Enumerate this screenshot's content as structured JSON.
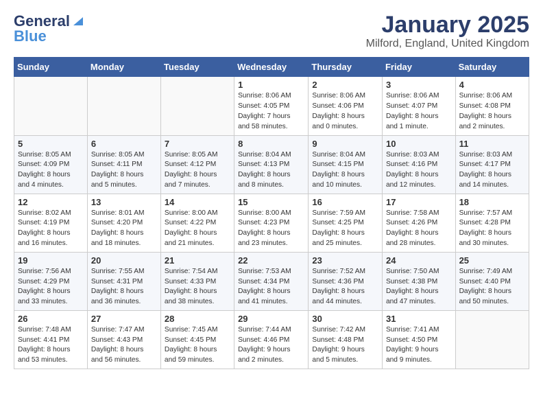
{
  "header": {
    "logo_general": "General",
    "logo_blue": "Blue",
    "title": "January 2025",
    "subtitle": "Milford, England, United Kingdom"
  },
  "days_of_week": [
    "Sunday",
    "Monday",
    "Tuesday",
    "Wednesday",
    "Thursday",
    "Friday",
    "Saturday"
  ],
  "weeks": [
    [
      {
        "day": "",
        "info": ""
      },
      {
        "day": "",
        "info": ""
      },
      {
        "day": "",
        "info": ""
      },
      {
        "day": "1",
        "info": "Sunrise: 8:06 AM\nSunset: 4:05 PM\nDaylight: 7 hours\nand 58 minutes."
      },
      {
        "day": "2",
        "info": "Sunrise: 8:06 AM\nSunset: 4:06 PM\nDaylight: 8 hours\nand 0 minutes."
      },
      {
        "day": "3",
        "info": "Sunrise: 8:06 AM\nSunset: 4:07 PM\nDaylight: 8 hours\nand 1 minute."
      },
      {
        "day": "4",
        "info": "Sunrise: 8:06 AM\nSunset: 4:08 PM\nDaylight: 8 hours\nand 2 minutes."
      }
    ],
    [
      {
        "day": "5",
        "info": "Sunrise: 8:05 AM\nSunset: 4:09 PM\nDaylight: 8 hours\nand 4 minutes."
      },
      {
        "day": "6",
        "info": "Sunrise: 8:05 AM\nSunset: 4:11 PM\nDaylight: 8 hours\nand 5 minutes."
      },
      {
        "day": "7",
        "info": "Sunrise: 8:05 AM\nSunset: 4:12 PM\nDaylight: 8 hours\nand 7 minutes."
      },
      {
        "day": "8",
        "info": "Sunrise: 8:04 AM\nSunset: 4:13 PM\nDaylight: 8 hours\nand 8 minutes."
      },
      {
        "day": "9",
        "info": "Sunrise: 8:04 AM\nSunset: 4:15 PM\nDaylight: 8 hours\nand 10 minutes."
      },
      {
        "day": "10",
        "info": "Sunrise: 8:03 AM\nSunset: 4:16 PM\nDaylight: 8 hours\nand 12 minutes."
      },
      {
        "day": "11",
        "info": "Sunrise: 8:03 AM\nSunset: 4:17 PM\nDaylight: 8 hours\nand 14 minutes."
      }
    ],
    [
      {
        "day": "12",
        "info": "Sunrise: 8:02 AM\nSunset: 4:19 PM\nDaylight: 8 hours\nand 16 minutes."
      },
      {
        "day": "13",
        "info": "Sunrise: 8:01 AM\nSunset: 4:20 PM\nDaylight: 8 hours\nand 18 minutes."
      },
      {
        "day": "14",
        "info": "Sunrise: 8:00 AM\nSunset: 4:22 PM\nDaylight: 8 hours\nand 21 minutes."
      },
      {
        "day": "15",
        "info": "Sunrise: 8:00 AM\nSunset: 4:23 PM\nDaylight: 8 hours\nand 23 minutes."
      },
      {
        "day": "16",
        "info": "Sunrise: 7:59 AM\nSunset: 4:25 PM\nDaylight: 8 hours\nand 25 minutes."
      },
      {
        "day": "17",
        "info": "Sunrise: 7:58 AM\nSunset: 4:26 PM\nDaylight: 8 hours\nand 28 minutes."
      },
      {
        "day": "18",
        "info": "Sunrise: 7:57 AM\nSunset: 4:28 PM\nDaylight: 8 hours\nand 30 minutes."
      }
    ],
    [
      {
        "day": "19",
        "info": "Sunrise: 7:56 AM\nSunset: 4:29 PM\nDaylight: 8 hours\nand 33 minutes."
      },
      {
        "day": "20",
        "info": "Sunrise: 7:55 AM\nSunset: 4:31 PM\nDaylight: 8 hours\nand 36 minutes."
      },
      {
        "day": "21",
        "info": "Sunrise: 7:54 AM\nSunset: 4:33 PM\nDaylight: 8 hours\nand 38 minutes."
      },
      {
        "day": "22",
        "info": "Sunrise: 7:53 AM\nSunset: 4:34 PM\nDaylight: 8 hours\nand 41 minutes."
      },
      {
        "day": "23",
        "info": "Sunrise: 7:52 AM\nSunset: 4:36 PM\nDaylight: 8 hours\nand 44 minutes."
      },
      {
        "day": "24",
        "info": "Sunrise: 7:50 AM\nSunset: 4:38 PM\nDaylight: 8 hours\nand 47 minutes."
      },
      {
        "day": "25",
        "info": "Sunrise: 7:49 AM\nSunset: 4:40 PM\nDaylight: 8 hours\nand 50 minutes."
      }
    ],
    [
      {
        "day": "26",
        "info": "Sunrise: 7:48 AM\nSunset: 4:41 PM\nDaylight: 8 hours\nand 53 minutes."
      },
      {
        "day": "27",
        "info": "Sunrise: 7:47 AM\nSunset: 4:43 PM\nDaylight: 8 hours\nand 56 minutes."
      },
      {
        "day": "28",
        "info": "Sunrise: 7:45 AM\nSunset: 4:45 PM\nDaylight: 8 hours\nand 59 minutes."
      },
      {
        "day": "29",
        "info": "Sunrise: 7:44 AM\nSunset: 4:46 PM\nDaylight: 9 hours\nand 2 minutes."
      },
      {
        "day": "30",
        "info": "Sunrise: 7:42 AM\nSunset: 4:48 PM\nDaylight: 9 hours\nand 5 minutes."
      },
      {
        "day": "31",
        "info": "Sunrise: 7:41 AM\nSunset: 4:50 PM\nDaylight: 9 hours\nand 9 minutes."
      },
      {
        "day": "",
        "info": ""
      }
    ]
  ]
}
